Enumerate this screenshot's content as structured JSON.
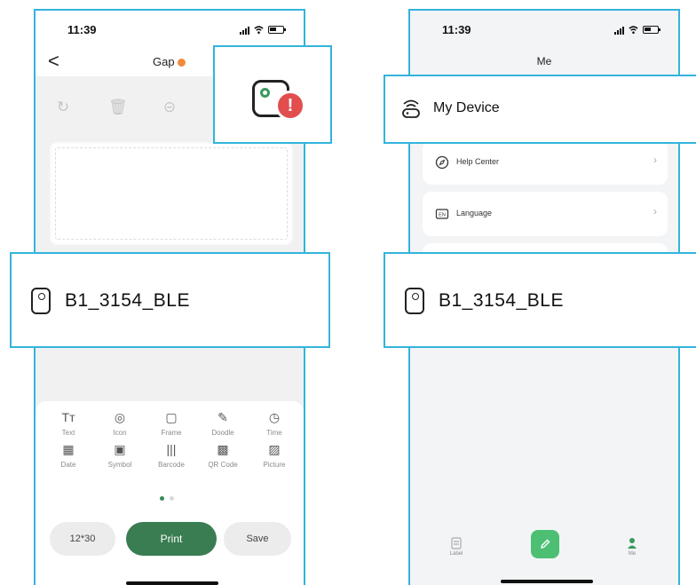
{
  "left_phone": {
    "status": {
      "time": "11:39"
    },
    "nav": {
      "back_glyph": "<",
      "title": "Gap"
    },
    "toolbox": {
      "items": [
        {
          "label": "Text",
          "glyph": "Tт",
          "icon": "text-icon"
        },
        {
          "label": "Icon",
          "glyph": "◎",
          "icon": "emoji-icon"
        },
        {
          "label": "Frame",
          "glyph": "▢",
          "icon": "frame-icon"
        },
        {
          "label": "Doodle",
          "glyph": "✎",
          "icon": "doodle-icon"
        },
        {
          "label": "Time",
          "glyph": "◷",
          "icon": "clock-icon"
        },
        {
          "label": "Date",
          "glyph": "▦",
          "icon": "calendar-icon"
        },
        {
          "label": "Symbol",
          "glyph": "▣",
          "icon": "symbol-icon"
        },
        {
          "label": "Barcode",
          "glyph": "|||",
          "icon": "barcode-icon"
        },
        {
          "label": "QR Code",
          "glyph": "▩",
          "icon": "qr-code-icon"
        },
        {
          "label": "Picture",
          "glyph": "▨",
          "icon": "picture-icon"
        }
      ]
    },
    "buttons": {
      "size": "12*30",
      "print": "Print",
      "save": "Save"
    }
  },
  "callouts": {
    "device_name": "B1_3154_BLE",
    "my_device": "My Device"
  },
  "right_phone": {
    "status": {
      "time": "11:39"
    },
    "title": "Me",
    "cards": [
      {
        "label": "Help Center",
        "icon": "compass-icon"
      },
      {
        "label": "Language",
        "icon": "language-icon"
      }
    ],
    "tabs": {
      "label": "Label",
      "me": "Me"
    }
  },
  "colors": {
    "accent_green": "#3a7d52",
    "highlight_blue": "#33b4dc",
    "alert_red": "#e24e4e",
    "gap_orange": "#f08a3c"
  }
}
